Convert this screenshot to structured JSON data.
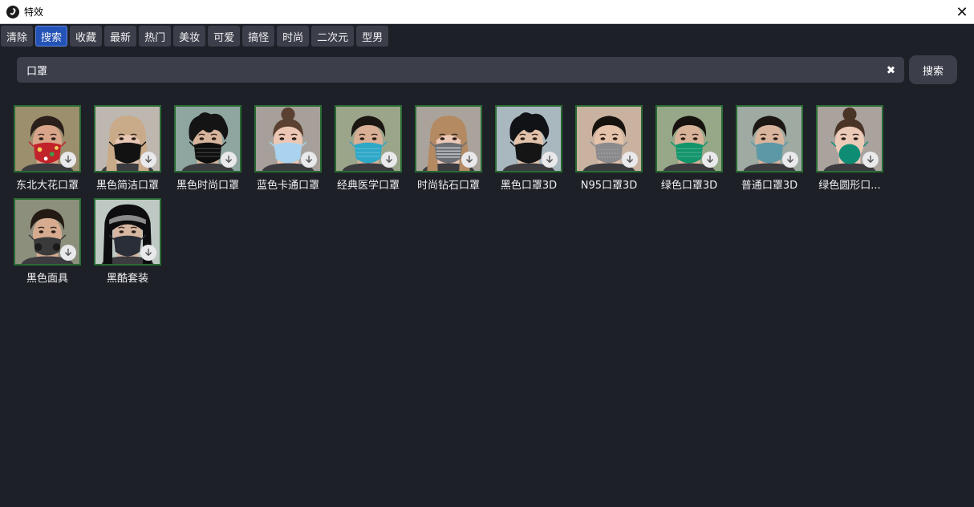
{
  "window": {
    "title": "特效",
    "close_glyph": "✕"
  },
  "tabs": [
    {
      "label": "清除",
      "active": false
    },
    {
      "label": "搜索",
      "active": true
    },
    {
      "label": "收藏",
      "active": false
    },
    {
      "label": "最新",
      "active": false
    },
    {
      "label": "热门",
      "active": false
    },
    {
      "label": "美妆",
      "active": false
    },
    {
      "label": "可爱",
      "active": false
    },
    {
      "label": "搞怪",
      "active": false
    },
    {
      "label": "时尚",
      "active": false
    },
    {
      "label": "二次元",
      "active": false
    },
    {
      "label": "型男",
      "active": false
    }
  ],
  "search": {
    "value": "口罩",
    "button_label": "搜索"
  },
  "items": [
    {
      "label": "东北大花口罩",
      "bg": "#9b8f6d",
      "skin": "#d9a58a",
      "hair": "#2a1f1a",
      "hair_style": "short",
      "mask": "#c2232b",
      "mask_style": "floral"
    },
    {
      "label": "黑色简洁口罩",
      "bg": "#bdb7b0",
      "skin": "#e8c7b5",
      "hair": "#c9ab8a",
      "hair_style": "long",
      "mask": "#121212",
      "mask_style": "plain"
    },
    {
      "label": "黑色时尚口罩",
      "bg": "#8fa6a0",
      "skin": "#d7b49c",
      "hair": "#141414",
      "hair_style": "messy",
      "mask": "#0e0e0e",
      "mask_style": "pleated"
    },
    {
      "label": "蓝色卡通口罩",
      "bg": "#a7a09a",
      "skin": "#ecc8b4",
      "hair": "#5a4030",
      "hair_style": "bun",
      "mask": "#a9d3ee",
      "mask_style": "plain"
    },
    {
      "label": "经典医学口罩",
      "bg": "#9aa58a",
      "skin": "#d9b096",
      "hair": "#1c1612",
      "hair_style": "short",
      "mask": "#2ea8c7",
      "mask_style": "pleated"
    },
    {
      "label": "时尚钻石口罩",
      "bg": "#aaa39b",
      "skin": "#ecc9b7",
      "hair": "#b48a63",
      "hair_style": "long",
      "mask": "#6c6f74",
      "mask_style": "diamond"
    },
    {
      "label": "黑色口罩3D",
      "bg": "#a9b7bf",
      "skin": "#e2c2aa",
      "hair": "#101216",
      "hair_style": "messy",
      "mask": "#151515",
      "mask_style": "plain"
    },
    {
      "label": "N95口罩3D",
      "bg": "#c9b3a0",
      "skin": "#e5c3ab",
      "hair": "#16130f",
      "hair_style": "short",
      "mask": "#8b8b8e",
      "mask_style": "dotted"
    },
    {
      "label": "绿色口罩3D",
      "bg": "#97a888",
      "skin": "#d8b39a",
      "hair": "#17120f",
      "hair_style": "short",
      "mask": "#13956c",
      "mask_style": "pleated"
    },
    {
      "label": "普通口罩3D",
      "bg": "#9eaaa2",
      "skin": "#dab59d",
      "hair": "#1c1713",
      "hair_style": "short",
      "mask": "#5c98a6",
      "mask_style": "plain"
    },
    {
      "label": "绿色圆形口...",
      "bg": "#a9a29d",
      "skin": "#eccab8",
      "hair": "#4a3426",
      "hair_style": "bun",
      "mask": "#0f8c74",
      "mask_style": "round"
    },
    {
      "label": "黑色面具",
      "bg": "#8c8f7c",
      "skin": "#d6ab90",
      "hair": "#241a14",
      "hair_style": "short",
      "mask": "#3a3a3a",
      "mask_style": "respirator"
    },
    {
      "label": "黑酷套装",
      "bg": "#bfc9c3",
      "skin": "#d7b7a1",
      "hair": "#0d0d0f",
      "hair_style": "hood",
      "mask": "#2a2e38",
      "mask_style": "plain"
    }
  ],
  "icons": {
    "app": "app-logo-icon",
    "close": "close-icon",
    "clear": "clear-icon",
    "download": "download-icon"
  }
}
